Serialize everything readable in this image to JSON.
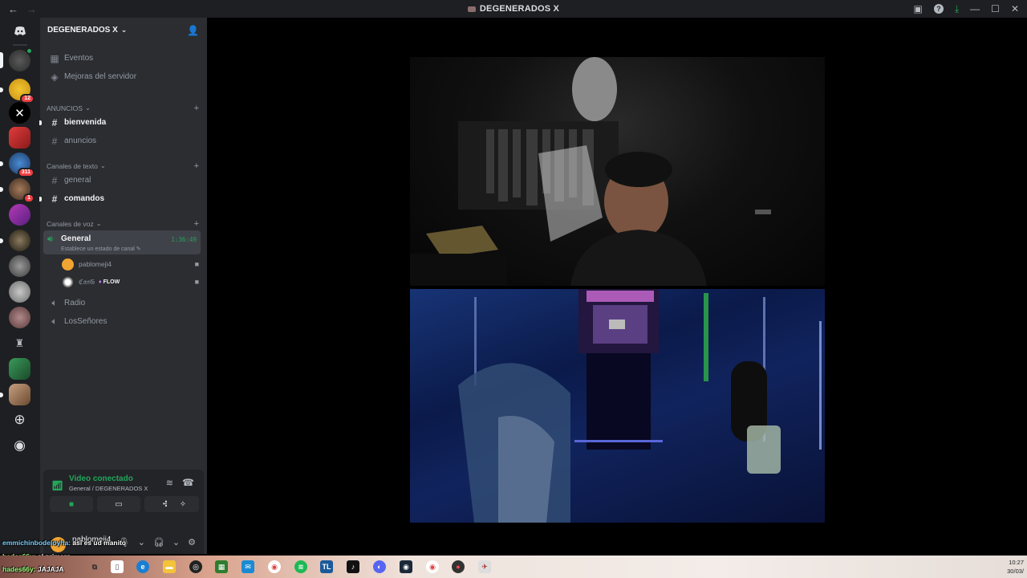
{
  "titlebar": {
    "title": "DEGENERADOS X"
  },
  "server": {
    "name": "DEGENERADOS X",
    "links": [
      {
        "label": "Eventos",
        "icon": "calendar-icon"
      },
      {
        "label": "Mejoras del servidor",
        "icon": "boost-icon"
      }
    ],
    "categories": [
      {
        "label": "ANUNCIOS"
      },
      {
        "label": "Canales de texto"
      },
      {
        "label": "Canales de voz"
      }
    ],
    "text_channels": [
      {
        "label": "bienvenida",
        "unread": true
      },
      {
        "label": "anuncios",
        "unread": false
      },
      {
        "label": "general",
        "unread": false
      },
      {
        "label": "comandos",
        "unread": true
      }
    ],
    "voice_channels": {
      "active": {
        "label": "General",
        "status_prompt": "Establece un estado de canal",
        "timer": "1:36:49",
        "users": [
          {
            "name": "pablomeji4",
            "avatar_color": "#f0a431"
          },
          {
            "name": "ℭ𝔞𝔫𝔊",
            "avatar_color": "#ffffff",
            "tag": "FLOW"
          }
        ]
      },
      "others": [
        {
          "label": "Radio"
        },
        {
          "label": "LosSeñores"
        }
      ]
    }
  },
  "rail": {
    "badges": [
      "12",
      "311",
      "1"
    ]
  },
  "voice_panel": {
    "status": "Video conectado",
    "location": "General / DEGENERADOS X"
  },
  "user_panel": {
    "username": "pablomeji4"
  },
  "chat_overlay": [
    {
      "nick": "emmichinbodeloyha:",
      "text": "asi es ud manito"
    },
    {
      "nick": "hades66y:",
      "text": "el primero"
    },
    {
      "nick": "hades66y:",
      "text": "JAJAJA"
    }
  ],
  "clock": {
    "time": "10:27",
    "date": "30/03/"
  },
  "colors": {
    "accent_green": "#23a55a",
    "sidebar_bg": "#2b2d31",
    "rail_bg": "#1e1f22",
    "badge_red": "#f23f43"
  }
}
